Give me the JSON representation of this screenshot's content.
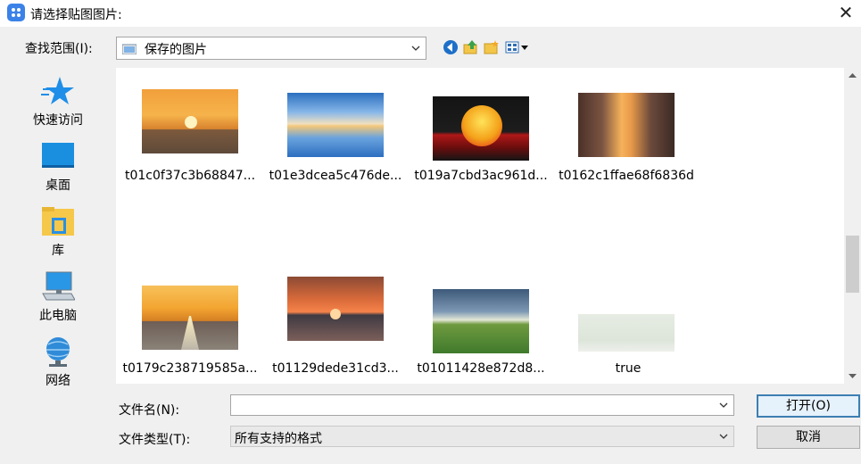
{
  "window": {
    "title": "请选择贴图图片:",
    "close_glyph": "✕"
  },
  "lookin": {
    "label": "查找范围(I):",
    "value": "保存的图片"
  },
  "places": [
    {
      "label": "快速访问",
      "icon": "star-icon"
    },
    {
      "label": "桌面",
      "icon": "desktop-icon"
    },
    {
      "label": "库",
      "icon": "library-icon"
    },
    {
      "label": "此电脑",
      "icon": "computer-icon"
    },
    {
      "label": "网络",
      "icon": "network-icon"
    }
  ],
  "files": [
    {
      "name": "t01c0f37c3b68847..."
    },
    {
      "name": "t01e3dcea5c476de..."
    },
    {
      "name": "t019a7cbd3ac961d..."
    },
    {
      "name": "t0162c1ffae68f6836d"
    },
    {
      "name": "t0179c238719585a..."
    },
    {
      "name": "t01129dede31cd3..."
    },
    {
      "name": "t01011428e872d8..."
    },
    {
      "name": "true"
    }
  ],
  "bottom": {
    "filename_label": "文件名(N):",
    "filename_value": "",
    "filetype_label": "文件类型(T):",
    "filetype_value": "所有支持的格式",
    "open_label": "打开(O)",
    "cancel_label": "取消"
  },
  "colors": {
    "dialog_bg": "#f0f0f0",
    "view_bg": "#ffffff",
    "default_button_border": "#3c7fb1",
    "icon_blue": "#1e88e5"
  }
}
